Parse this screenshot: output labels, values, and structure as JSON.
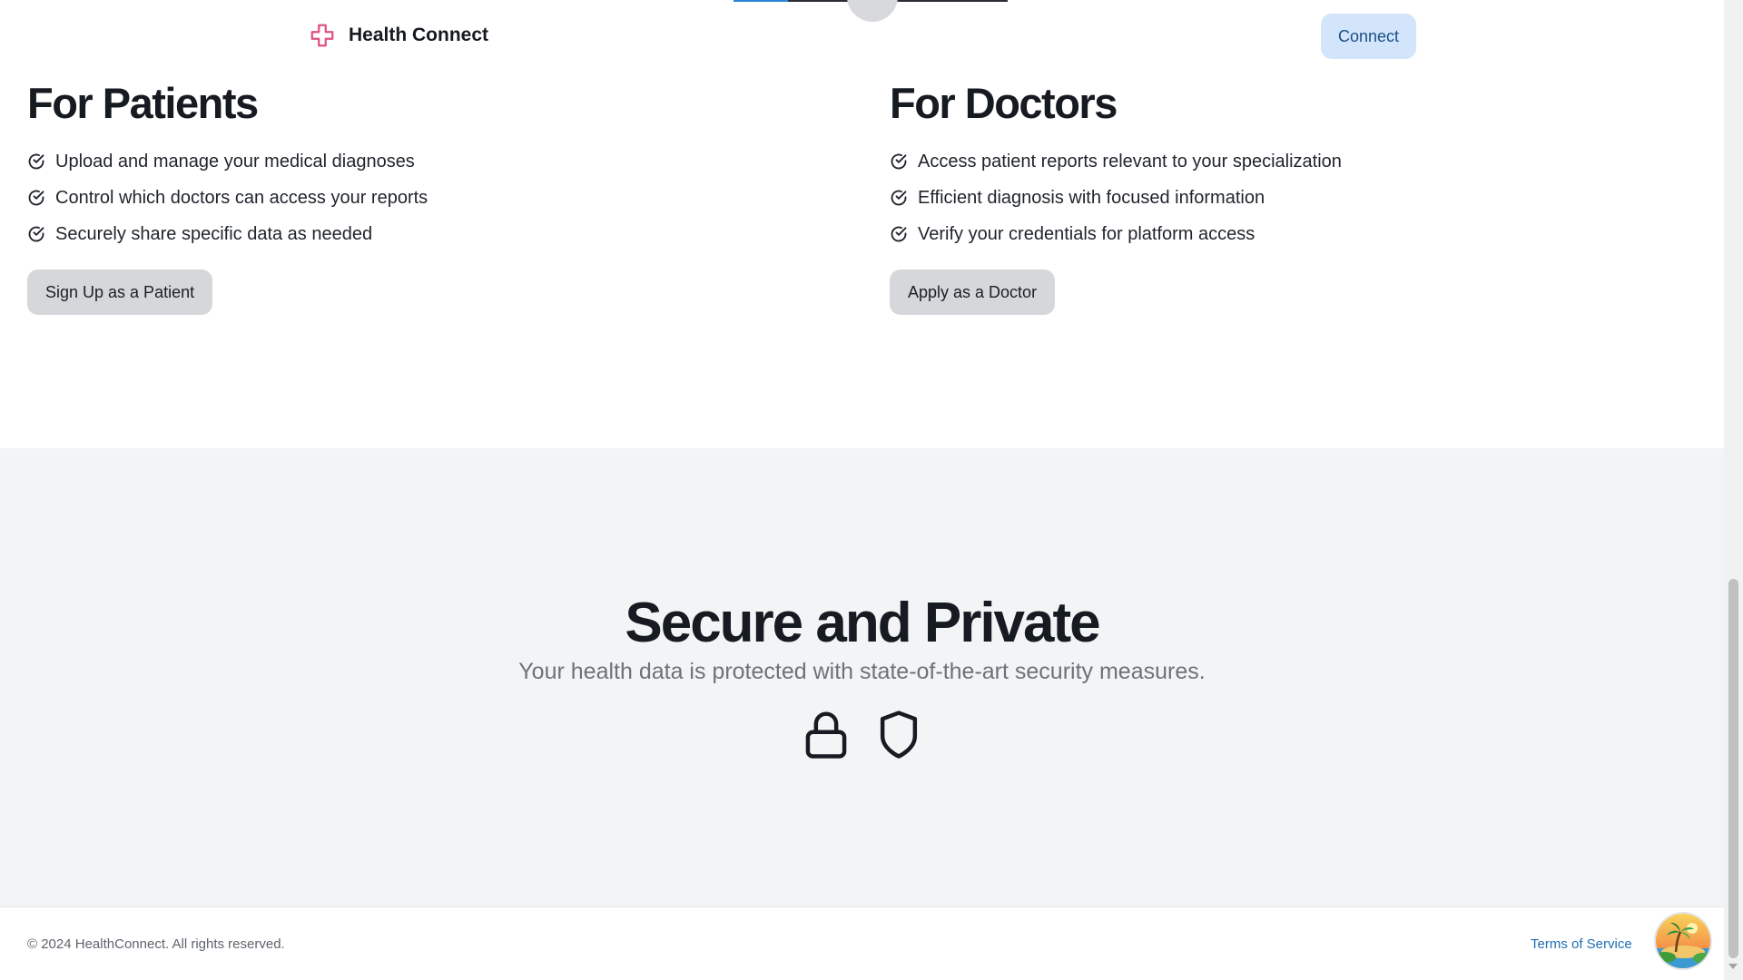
{
  "header": {
    "brand_name": "Health Connect",
    "connect_label": "Connect"
  },
  "patients": {
    "title": "For Patients",
    "items": [
      "Upload and manage your medical diagnoses",
      "Control which doctors can access your reports",
      "Securely share specific data as needed"
    ],
    "cta_label": "Sign Up as a Patient"
  },
  "doctors": {
    "title": "For Doctors",
    "items": [
      "Access patient reports relevant to your specialization",
      "Efficient diagnosis with focused information",
      "Verify your credentials for platform access"
    ],
    "cta_label": "Apply as a Doctor"
  },
  "secure": {
    "title": "Secure and Private",
    "subtitle": "Your health data is protected with state-of-the-art security measures.",
    "icons": [
      "lock-icon",
      "shield-icon"
    ]
  },
  "footer": {
    "copyright": "© 2024 HealthConnect. All rights reserved.",
    "terms_label": "Terms of Service"
  },
  "colors": {
    "brand_icon": "#e0527f",
    "connect_bg": "#d2e5fb",
    "section_bg": "#f3f4f6",
    "link": "#1f6fb5"
  }
}
